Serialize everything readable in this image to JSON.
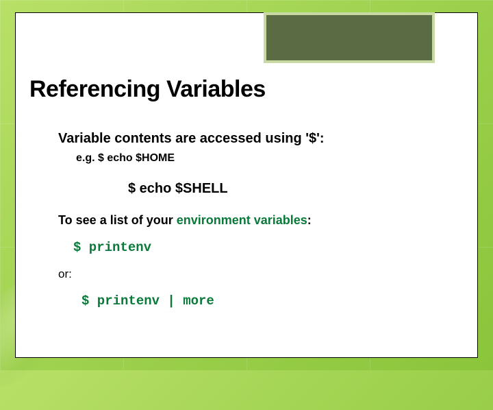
{
  "title": "Referencing Variables",
  "body": {
    "line1": "Variable contents are accessed using '$':",
    "line2_prefix": "e.g. ",
    "line2_cmd": "$ echo $HOME",
    "line3": "$ echo $SHELL",
    "line4_a": "To see a list of your ",
    "line4_b": "environment variables",
    "line4_c": ":",
    "line5": "$ printenv",
    "line6": "or:",
    "line7": "$ printenv | more"
  }
}
